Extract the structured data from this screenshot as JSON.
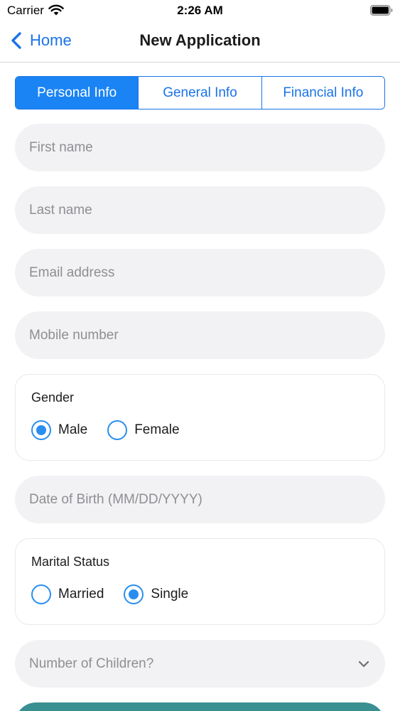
{
  "status_bar": {
    "carrier": "Carrier",
    "time": "2:26 AM"
  },
  "nav": {
    "back_label": "Home",
    "title": "New Application"
  },
  "tabs": [
    {
      "label": "Personal Info",
      "active": true
    },
    {
      "label": "General Info",
      "active": false
    },
    {
      "label": "Financial Info",
      "active": false
    }
  ],
  "fields": {
    "first_name": {
      "placeholder": "First name",
      "value": ""
    },
    "last_name": {
      "placeholder": "Last name",
      "value": ""
    },
    "email": {
      "placeholder": "Email address",
      "value": ""
    },
    "mobile": {
      "placeholder": "Mobile number",
      "value": ""
    },
    "dob": {
      "placeholder": "Date of Birth (MM/DD/YYYY)",
      "value": ""
    }
  },
  "gender": {
    "title": "Gender",
    "options": [
      {
        "label": "Male",
        "selected": true
      },
      {
        "label": "Female",
        "selected": false
      }
    ]
  },
  "marital_status": {
    "title": "Marital Status",
    "options": [
      {
        "label": "Married",
        "selected": false
      },
      {
        "label": "Single",
        "selected": true
      }
    ]
  },
  "children_select": {
    "placeholder": "Number of Children?"
  },
  "colors": {
    "accent": "#1a73e8",
    "segment_active": "#1a84f5",
    "radio": "#2a8ef0",
    "field_bg": "#f2f2f4",
    "button": "#3a8f91"
  }
}
